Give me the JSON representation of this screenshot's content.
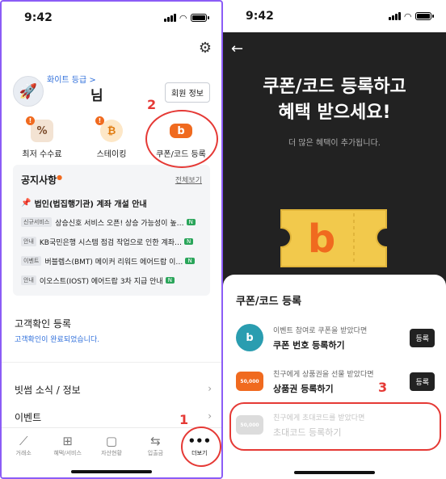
{
  "left": {
    "status_time": "9:42",
    "profile": {
      "grade": "화이트 등급 >",
      "nickname": "님",
      "member_button": "회원 정보"
    },
    "quick": [
      {
        "label": "최저 수수료",
        "badge": "!"
      },
      {
        "label": "스테이킹",
        "badge": "!"
      },
      {
        "label": "쿠폰/코드 등록"
      }
    ],
    "notice": {
      "title": "공지사항",
      "more": "전체보기",
      "rows": [
        {
          "tag": "",
          "text": "법인(법집행기관) 계좌 개설 안내",
          "new": ""
        },
        {
          "tag": "신규서비스",
          "text": "상승신호 서비스 오픈! 상승 가능성이 높…",
          "new": "N"
        },
        {
          "tag": "안내",
          "text": "KB국민은행 시스템 점검 작업으로 인한 계좌…",
          "new": "N"
        },
        {
          "tag": "이벤트",
          "text": "버블렙스(BMT) 메이커 리워드 에어드랍 이…",
          "new": "N"
        },
        {
          "tag": "안내",
          "text": "이오스트(IOST) 에어드랍 3차 지급 안내",
          "new": "N"
        }
      ]
    },
    "kyc": {
      "title": "고객확인 등록",
      "status": "고객확인이 완료되었습니다."
    },
    "menu": [
      {
        "label": "빗썸 소식 / 정보"
      },
      {
        "label": "이벤트"
      }
    ],
    "tabs": [
      {
        "label": "거래소",
        "icon": "chart-icon"
      },
      {
        "label": "혜택/서비스",
        "icon": "grid-icon"
      },
      {
        "label": "자산현황",
        "icon": "wallet-icon"
      },
      {
        "label": "입출금",
        "icon": "transfer-icon"
      },
      {
        "label": "더보기",
        "icon": "more-icon"
      }
    ]
  },
  "right": {
    "status_time": "9:42",
    "hero_line1": "쿠폰/코드 등록하고",
    "hero_line2": "혜택 받으세요!",
    "hero_sub": "더 많은 혜택이 추가됩니다.",
    "sheet_title": "쿠폰/코드 등록",
    "options": [
      {
        "sub": "이벤트 참여로 쿠폰을 받았다면",
        "main": "쿠폰 번호 등록하기",
        "button": "등록",
        "icon_text": "b"
      },
      {
        "sub": "친구에게 상품권을 선물 받았다면",
        "main": "상품권 등록하기",
        "button": "등록",
        "icon_text": "50,000"
      },
      {
        "sub": "친구에게 초대코드를 받았다면",
        "main": "초대코드 등록하기",
        "icon_text": "50,000"
      }
    ]
  },
  "annotations": {
    "n1": "1",
    "n2": "2",
    "n3": "3"
  },
  "colors": {
    "accent": "#f06a1f",
    "annotation": "#e53935",
    "frame": "#8b5cf6",
    "dark_bg": "#222222"
  }
}
